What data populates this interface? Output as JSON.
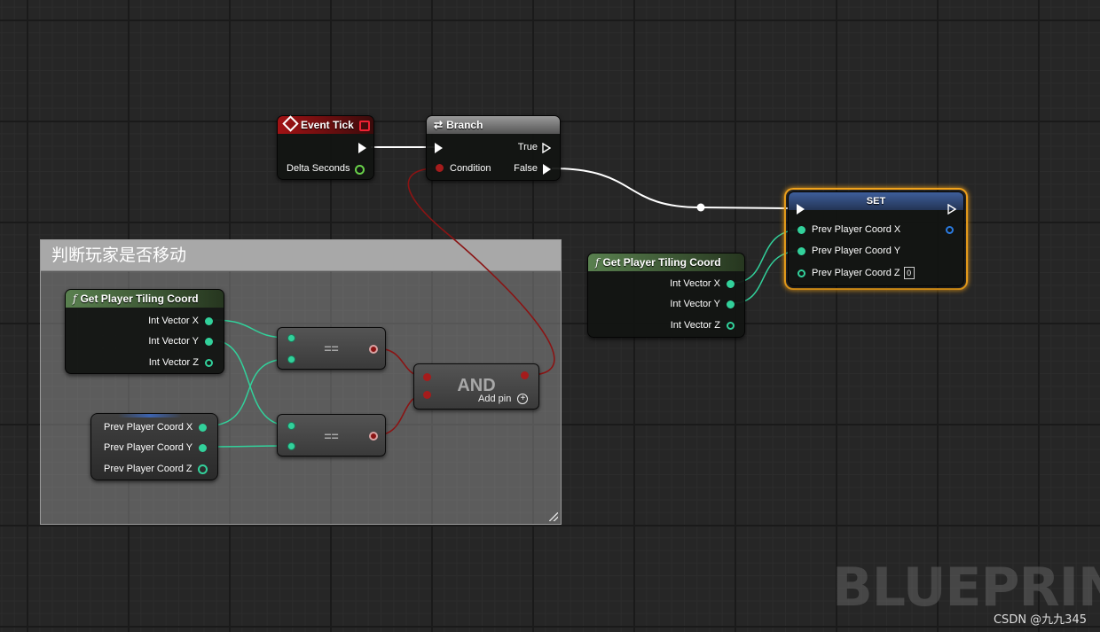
{
  "comment": {
    "title": "判断玩家是否移动"
  },
  "event_tick": {
    "title": "Event Tick",
    "delta_seconds": "Delta Seconds"
  },
  "branch": {
    "title": "Branch",
    "true_label": "True",
    "false_label": "False",
    "condition_label": "Condition"
  },
  "get_tiling_left": {
    "title": "Get Player Tiling Coord",
    "x": "Int Vector X",
    "y": "Int Vector Y",
    "z": "Int Vector Z"
  },
  "get_tiling_right": {
    "title": "Get Player Tiling Coord",
    "x": "Int Vector X",
    "y": "Int Vector Y",
    "z": "Int Vector Z"
  },
  "prev_coord_vars": {
    "x": "Prev Player Coord X",
    "y": "Prev Player Coord Y",
    "z": "Prev Player Coord Z"
  },
  "equal_nodes": {
    "op": "=="
  },
  "and_node": {
    "title": "AND",
    "add_pin": "Add pin"
  },
  "set_node": {
    "title": "SET",
    "x": "Prev Player Coord X",
    "y": "Prev Player Coord Y",
    "z": "Prev Player Coord Z",
    "z_default": "0"
  },
  "watermark": "BLUEPRINT",
  "credit": "CSDN @九九345",
  "colors": {
    "float_pin": "#32d19b",
    "bool_pin": "#a51c1c",
    "exec_wire": "#ffffff",
    "selection": "#f0a21c"
  }
}
